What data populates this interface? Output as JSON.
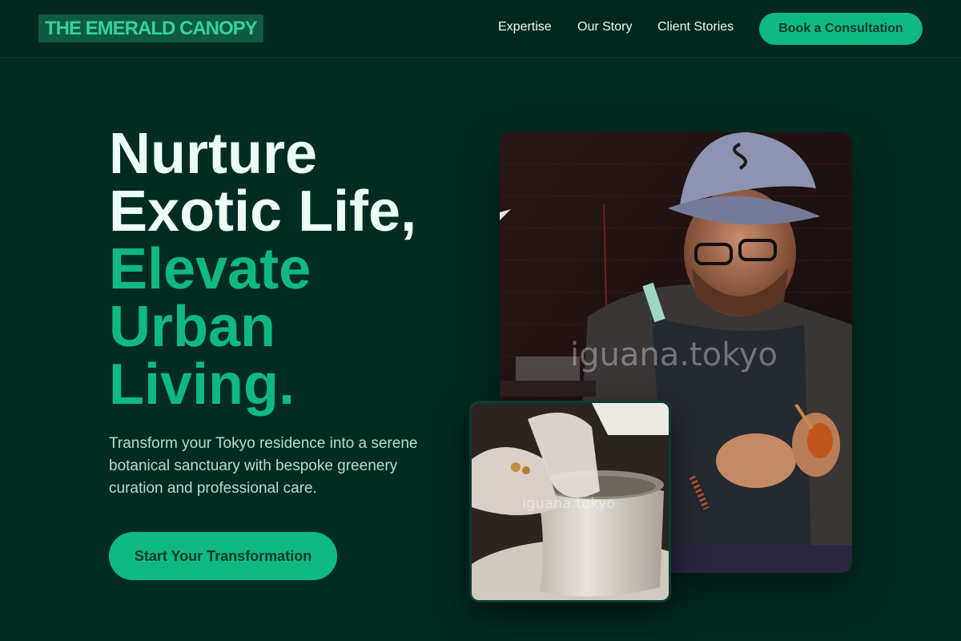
{
  "brand": {
    "logo_text": "THE EMERALD CANOPY"
  },
  "nav": {
    "links": [
      {
        "label": "Expertise"
      },
      {
        "label": "Our Story"
      },
      {
        "label": "Client Stories"
      }
    ],
    "cta_label": "Book a Consultation"
  },
  "hero": {
    "headline_white": [
      "Nurture",
      "Exotic Life,"
    ],
    "headline_green": [
      "Elevate",
      "Urban",
      "Living."
    ],
    "subtitle": "Transform your Tokyo residence into a serene botanical sanctuary with bespoke greenery curation and professional care.",
    "cta_label": "Start Your Transformation"
  },
  "images": {
    "main_watermark": "iguana.tokyo",
    "small_watermark": "iguana.tokyo"
  },
  "colors": {
    "background": "#022c22",
    "accent": "#10b981",
    "text": "#ecfdf5"
  }
}
